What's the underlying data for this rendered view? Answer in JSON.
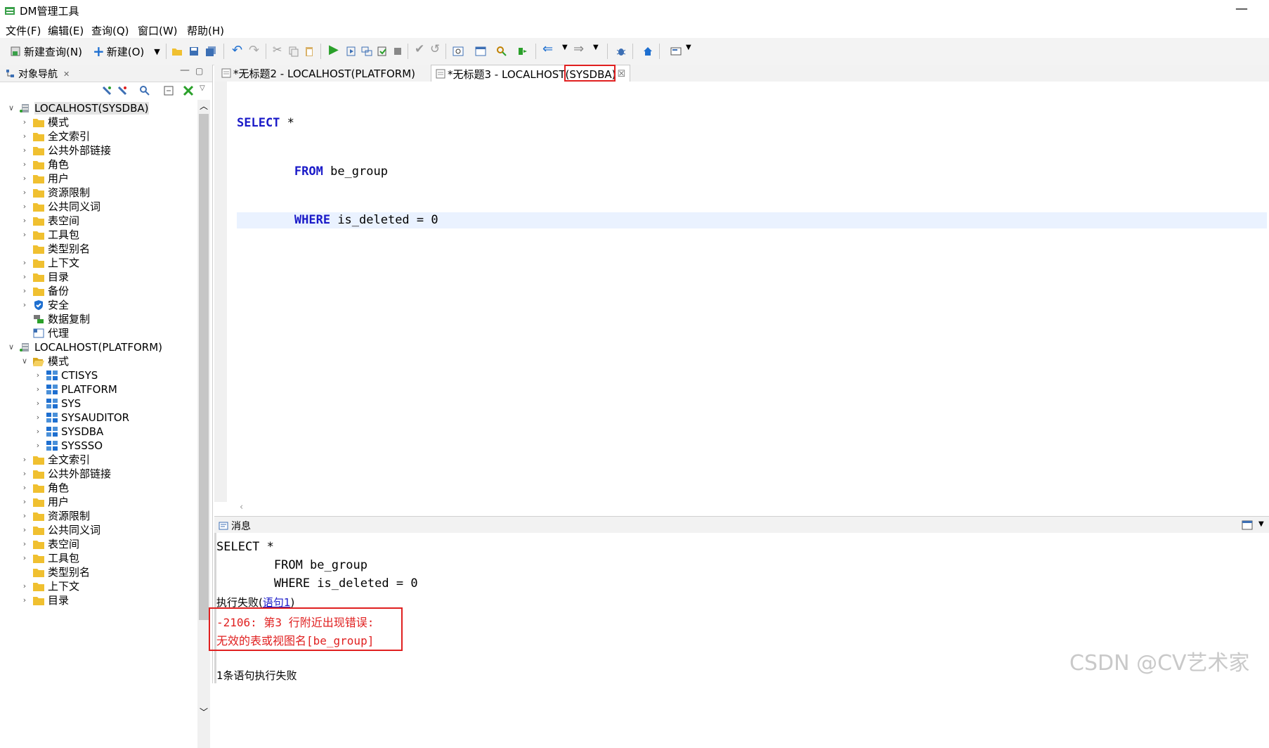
{
  "window": {
    "title": "DM管理工具",
    "minimize_glyph": "—"
  },
  "menu": [
    "文件(F)",
    "编辑(E)",
    "查询(Q)",
    "窗口(W)",
    "帮助(H)"
  ],
  "toolbar": {
    "new_query": "新建查询(N)",
    "new": "新建(O)"
  },
  "nav": {
    "tab_label": "对象导航",
    "tree": [
      {
        "label": "LOCALHOST(SYSDBA)",
        "level": 0,
        "twisty": "expanded",
        "icon": "server-icon"
      },
      {
        "label": "模式",
        "level": 1,
        "twisty": "collapsed",
        "icon": "folder-icon"
      },
      {
        "label": "全文索引",
        "level": 1,
        "twisty": "collapsed",
        "icon": "folder-icon"
      },
      {
        "label": "公共外部链接",
        "level": 1,
        "twisty": "collapsed",
        "icon": "folder-icon"
      },
      {
        "label": "角色",
        "level": 1,
        "twisty": "collapsed",
        "icon": "folder-icon"
      },
      {
        "label": "用户",
        "level": 1,
        "twisty": "collapsed",
        "icon": "folder-icon"
      },
      {
        "label": "资源限制",
        "level": 1,
        "twisty": "collapsed",
        "icon": "folder-icon"
      },
      {
        "label": "公共同义词",
        "level": 1,
        "twisty": "collapsed",
        "icon": "folder-icon"
      },
      {
        "label": "表空间",
        "level": 1,
        "twisty": "collapsed",
        "icon": "folder-icon"
      },
      {
        "label": "工具包",
        "level": 1,
        "twisty": "collapsed",
        "icon": "folder-icon"
      },
      {
        "label": "类型别名",
        "level": 1,
        "twisty": "none",
        "icon": "folder-icon"
      },
      {
        "label": "上下文",
        "level": 1,
        "twisty": "collapsed",
        "icon": "folder-icon"
      },
      {
        "label": "目录",
        "level": 1,
        "twisty": "collapsed",
        "icon": "folder-icon"
      },
      {
        "label": "备份",
        "level": 1,
        "twisty": "collapsed",
        "icon": "folder-icon"
      },
      {
        "label": "安全",
        "level": 1,
        "twisty": "collapsed",
        "icon": "shield-icon"
      },
      {
        "label": "数据复制",
        "level": 1,
        "twisty": "none",
        "icon": "replication-icon"
      },
      {
        "label": "代理",
        "level": 1,
        "twisty": "none",
        "icon": "agent-icon"
      },
      {
        "label": "LOCALHOST(PLATFORM)",
        "level": 0,
        "twisty": "expanded",
        "icon": "server-icon"
      },
      {
        "label": "模式",
        "level": 1,
        "twisty": "expanded",
        "icon": "folder-open-icon"
      },
      {
        "label": "CTISYS",
        "level": 2,
        "twisty": "collapsed",
        "icon": "schema-icon"
      },
      {
        "label": "PLATFORM",
        "level": 2,
        "twisty": "collapsed",
        "icon": "schema-icon"
      },
      {
        "label": "SYS",
        "level": 2,
        "twisty": "collapsed",
        "icon": "schema-icon"
      },
      {
        "label": "SYSAUDITOR",
        "level": 2,
        "twisty": "collapsed",
        "icon": "schema-icon"
      },
      {
        "label": "SYSDBA",
        "level": 2,
        "twisty": "collapsed",
        "icon": "schema-icon"
      },
      {
        "label": "SYSSSO",
        "level": 2,
        "twisty": "collapsed",
        "icon": "schema-icon"
      },
      {
        "label": "全文索引",
        "level": 1,
        "twisty": "collapsed",
        "icon": "folder-icon"
      },
      {
        "label": "公共外部链接",
        "level": 1,
        "twisty": "collapsed",
        "icon": "folder-icon"
      },
      {
        "label": "角色",
        "level": 1,
        "twisty": "collapsed",
        "icon": "folder-icon"
      },
      {
        "label": "用户",
        "level": 1,
        "twisty": "collapsed",
        "icon": "folder-icon"
      },
      {
        "label": "资源限制",
        "level": 1,
        "twisty": "collapsed",
        "icon": "folder-icon"
      },
      {
        "label": "公共同义词",
        "level": 1,
        "twisty": "collapsed",
        "icon": "folder-icon"
      },
      {
        "label": "表空间",
        "level": 1,
        "twisty": "collapsed",
        "icon": "folder-icon"
      },
      {
        "label": "工具包",
        "level": 1,
        "twisty": "collapsed",
        "icon": "folder-icon"
      },
      {
        "label": "类型别名",
        "level": 1,
        "twisty": "none",
        "icon": "folder-icon"
      },
      {
        "label": "上下文",
        "level": 1,
        "twisty": "collapsed",
        "icon": "folder-icon"
      },
      {
        "label": "目录",
        "level": 1,
        "twisty": "collapsed",
        "icon": "folder-icon"
      }
    ]
  },
  "editor": {
    "tabs": [
      {
        "label": "*无标题2 - LOCALHOST(PLATFORM)",
        "active": false
      },
      {
        "label": "*无标题3 - LOCALHOST(SYSDBA)",
        "active": true
      }
    ],
    "close_glyph": "☒",
    "lines": [
      {
        "kw": "SELECT",
        "rest": " *",
        "indent": ""
      },
      {
        "kw": "FROM",
        "rest": " be_group",
        "indent": "        "
      },
      {
        "kw": "WHERE",
        "rest": " is_deleted = 0",
        "indent": "        "
      }
    ]
  },
  "messages": {
    "tab_label": "消息",
    "sql_lines": [
      "SELECT *",
      "        FROM be_group",
      "        WHERE is_deleted = 0"
    ],
    "fail_prefix": "执行失败(",
    "fail_link": "语句1",
    "fail_suffix": ")",
    "error_line1": "-2106: 第3 行附近出现错误:",
    "error_line2": "无效的表或视图名[be_group]",
    "summary": "1条语句执行失败"
  },
  "watermark": "CSDN @CV艺术家",
  "colors": {
    "keyword": "#1a1ac8",
    "error": "#e02020",
    "folder": "#f0c030",
    "highlight_line": "#eaf2ff"
  }
}
